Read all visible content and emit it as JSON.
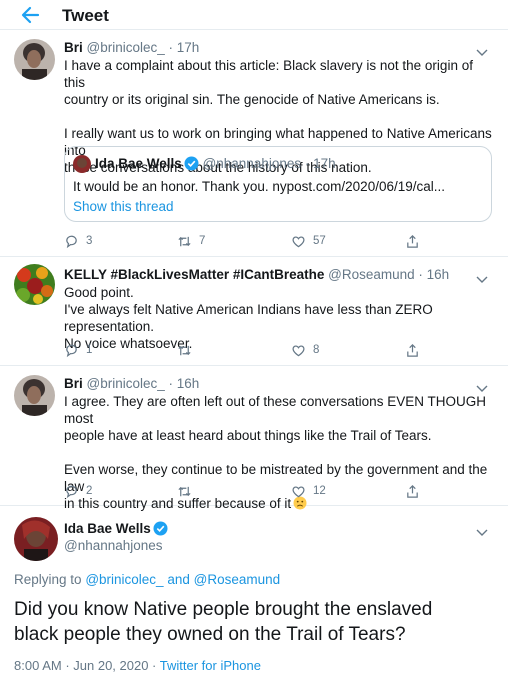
{
  "header": {
    "title": "Tweet"
  },
  "tweets": [
    {
      "name": "Bri",
      "handle": "@brinicolec_",
      "time": "· 17h",
      "lines": [
        "I have a complaint about this article: Black slavery is not the origin of this",
        "country or its original sin. The genocide of Native Americans is.",
        "",
        "I really want us to work on bringing what happened to Native Americans into",
        "these conversations about the history of this nation."
      ],
      "quote": {
        "name": "Ida Bae Wells",
        "handle": "@nhannahjones",
        "time": "· 17h",
        "text": "It would be an honor. Thank you. nypost.com/2020/06/19/cal...",
        "show_thread": "Show this thread"
      },
      "replies": "3",
      "retweets": "7",
      "likes": "57"
    },
    {
      "name": "KELLY #BlackLivesMatter #ICantBreathe",
      "handle": "@Roseamund",
      "time": "· 16h",
      "lines": [
        "Good point.",
        "I've always felt Native American Indians have less than ZERO representation.",
        "No voice whatsoever."
      ],
      "replies": "1",
      "retweets": "",
      "likes": "8"
    },
    {
      "name": "Bri",
      "handle": "@brinicolec_",
      "time": "· 16h",
      "lines": [
        "I agree. They are often left out of these conversations EVEN THOUGH most",
        "people have at least heard about things like the Trail of Tears.",
        "",
        "Even worse, they continue to be mistreated by the government and the law",
        "in this country and suffer because of it"
      ],
      "emoji": "frowning-face-emoji",
      "replies": "2",
      "retweets": "",
      "likes": "12"
    }
  ],
  "main": {
    "name": "Ida Bae Wells",
    "handle": "@nhannahjones",
    "replying_prefix": "Replying to",
    "replying_to_1": "@brinicolec_",
    "replying_and": "and",
    "replying_to_2": "@Roseamund",
    "text_line1": "Did you know Native people brought the enslaved",
    "text_line2": "black people they owned on the Trail of Tears?",
    "time": "8:00 AM",
    "date": "· Jun 20, 2020 ·",
    "source": "Twitter for iPhone"
  },
  "colors": {
    "accent": "#1da1f2",
    "muted": "#657786",
    "text": "#14171a",
    "border": "#e6ecf0"
  }
}
